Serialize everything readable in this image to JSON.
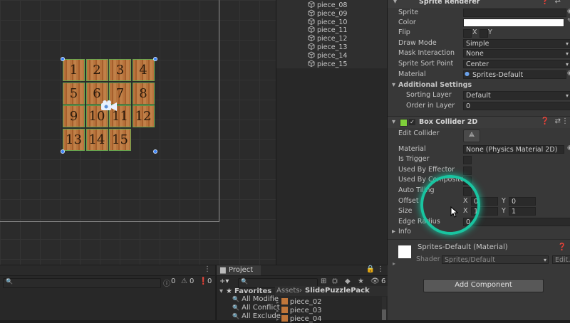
{
  "hierarchy": {
    "items": [
      "piece_08",
      "piece_09",
      "piece_10",
      "piece_11",
      "piece_12",
      "piece_13",
      "piece_14",
      "piece_15"
    ]
  },
  "puzzle": {
    "tiles": [
      "1",
      "2",
      "3",
      "4",
      "5",
      "6",
      "7",
      "8",
      "9",
      "10",
      "11",
      "12",
      "13",
      "14",
      "15"
    ]
  },
  "inspector": {
    "sprite_renderer": {
      "title": "Sprite Renderer",
      "sprite_label": "Sprite",
      "color_label": "Color",
      "flip_label": "Flip",
      "flip_x": "X",
      "flip_y": "Y",
      "draw_mode_label": "Draw Mode",
      "draw_mode_value": "Simple",
      "mask_label": "Mask Interaction",
      "mask_value": "None",
      "sort_point_label": "Sprite Sort Point",
      "sort_point_value": "Center",
      "material_label": "Material",
      "material_value": "Sprites-Default",
      "additional_label": "Additional Settings",
      "sorting_layer_label": "Sorting Layer",
      "sorting_layer_value": "Default",
      "order_label": "Order in Layer",
      "order_value": "0"
    },
    "box_collider": {
      "title": "Box Collider 2D",
      "edit_label": "Edit Collider",
      "material_label": "Material",
      "material_value": "None (Physics Material 2D)",
      "trigger_label": "Is Trigger",
      "effector_label": "Used By Effector",
      "composite_label": "Used By Composite",
      "autotiling_label": "Auto Tiling",
      "offset_label": "Offset",
      "offset_x": "0",
      "offset_y": "0",
      "size_label": "Size",
      "size_x": "1",
      "size_y": "1",
      "edge_label": "Edge Radius",
      "edge_value": "0",
      "info_label": "Info",
      "x_letter": "X",
      "y_letter": "Y"
    },
    "material_block": {
      "title": "Sprites-Default (Material)",
      "shader_label": "Shader",
      "shader_value": "Sprites/Default",
      "edit_label": "Edit..."
    },
    "add_component": "Add Component"
  },
  "console": {
    "count_info": "0",
    "count_warn": "0",
    "count_error": "0"
  },
  "project": {
    "tab": "Project",
    "favorites": "Favorites",
    "fav_items": [
      "All Modifie",
      "All Conflict",
      "All Exclude"
    ],
    "breadcrumb_root": "Assets",
    "breadcrumb_sep": "›",
    "breadcrumb_folder": "SlidePuzzlePack",
    "files": [
      "piece_02",
      "piece_03",
      "piece_04"
    ],
    "hidden_count": "6"
  },
  "colors": {
    "accent": "#19c4a0",
    "tile_border": "#6aa84f",
    "handle": "#3b82f6"
  }
}
